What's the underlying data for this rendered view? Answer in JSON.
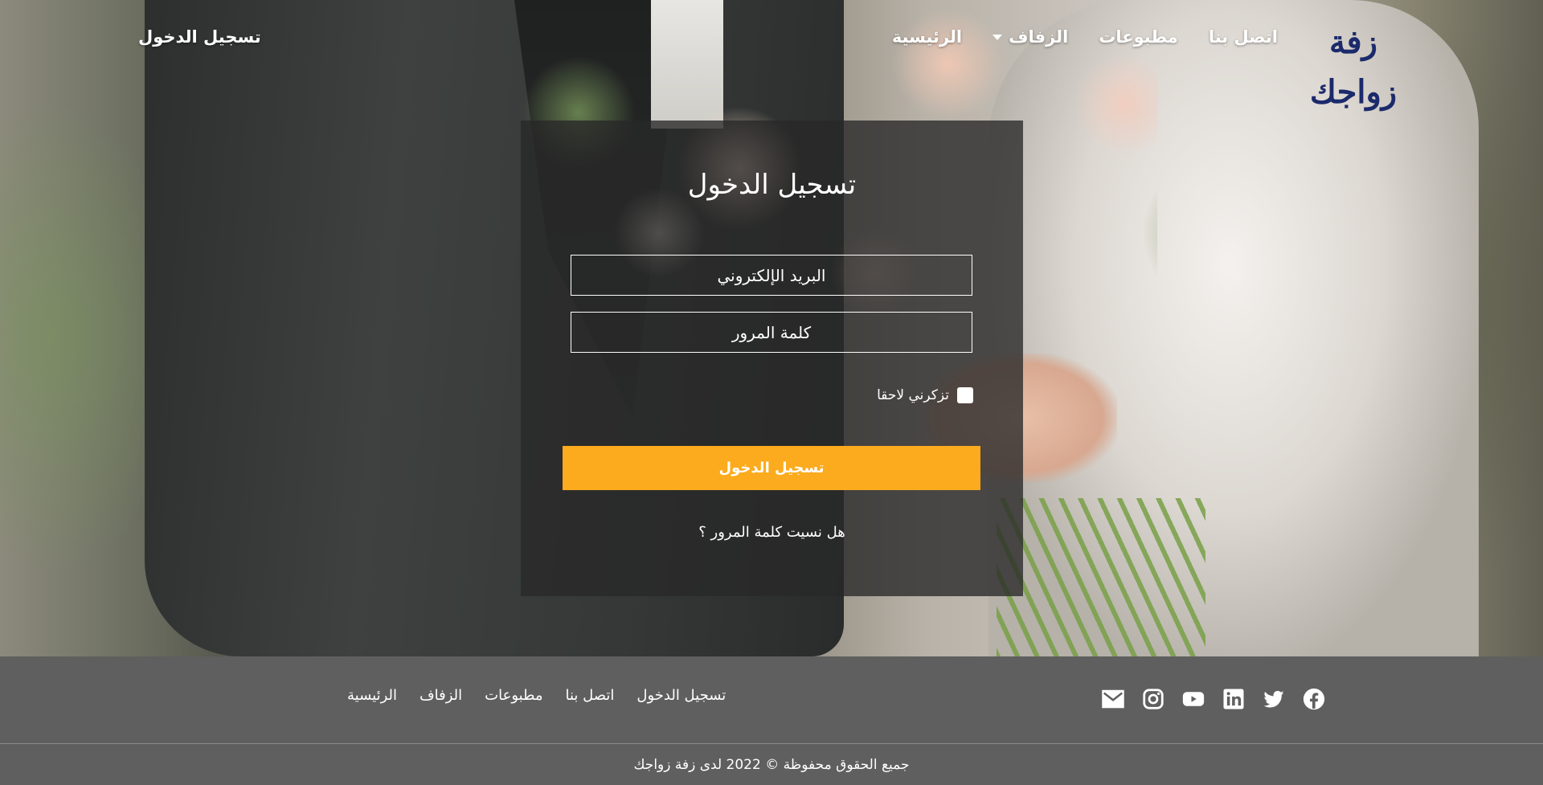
{
  "navbar": {
    "logo_text": "زفة زواجك",
    "links": [
      {
        "label": "الرئيسية"
      },
      {
        "label": "الزفاف",
        "has_dropdown": true
      },
      {
        "label": "مطبوعات"
      },
      {
        "label": "اتصل بنا"
      }
    ],
    "login_label": "تسجيل الدخول"
  },
  "login_form": {
    "title": "تسجيل الدخول",
    "email_placeholder": "البريد الإلكتروني",
    "password_placeholder": "كلمة المرور",
    "remember_label": "تزكرني لاحقا",
    "remember_checked": false,
    "submit_label": "تسجيل الدخول",
    "forgot_label": "هل نسيت كلمة المرور ؟"
  },
  "footer": {
    "social_icons": [
      "facebook-icon",
      "twitter-icon",
      "linkedin-icon",
      "youtube-icon",
      "instagram-icon",
      "email-icon"
    ],
    "links": [
      {
        "label": "الرئيسية"
      },
      {
        "label": "الزفاف"
      },
      {
        "label": "مطبوعات"
      },
      {
        "label": "اتصل بنا"
      },
      {
        "label": "تسجيل الدخول"
      }
    ],
    "copyright": "جميع الحقوق محفوظة © 2022 لدى زفة زواجك"
  },
  "colors": {
    "accent": "#fbab1d",
    "footer_bg": "#5f5f5f",
    "logo": "#1b2a6b"
  }
}
